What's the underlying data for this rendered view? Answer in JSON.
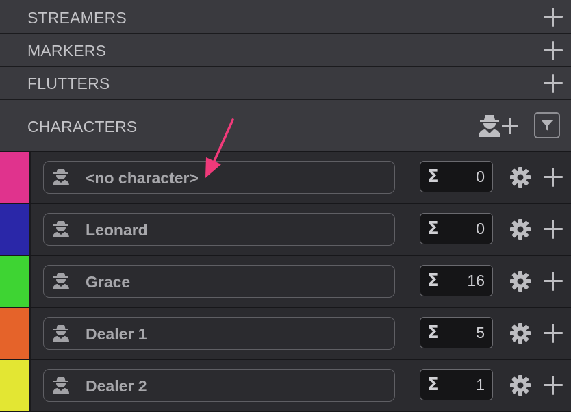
{
  "sections": [
    {
      "title": "STREAMERS"
    },
    {
      "title": "MARKERS"
    },
    {
      "title": "FLUTTERS"
    }
  ],
  "characters_header": {
    "title": "CHARACTERS",
    "add_icon": "add-character-icon",
    "filter_icon": "filter-icon"
  },
  "rows": [
    {
      "name": "<no character>",
      "color": "#e0338d",
      "count": "0"
    },
    {
      "name": "Leonard",
      "color": "#2a27a8",
      "count": "0"
    },
    {
      "name": "Grace",
      "color": "#3ed433",
      "count": "16"
    },
    {
      "name": "Dealer 1",
      "color": "#e5632a",
      "count": "5"
    },
    {
      "name": "Dealer 2",
      "color": "#e3e633",
      "count": "1"
    }
  ],
  "icons": {
    "sigma": "Σ",
    "settings": "gear-icon",
    "add": "plus-icon",
    "character": "character-icon"
  },
  "colors": {
    "annotation_arrow": "#f03a7a"
  }
}
